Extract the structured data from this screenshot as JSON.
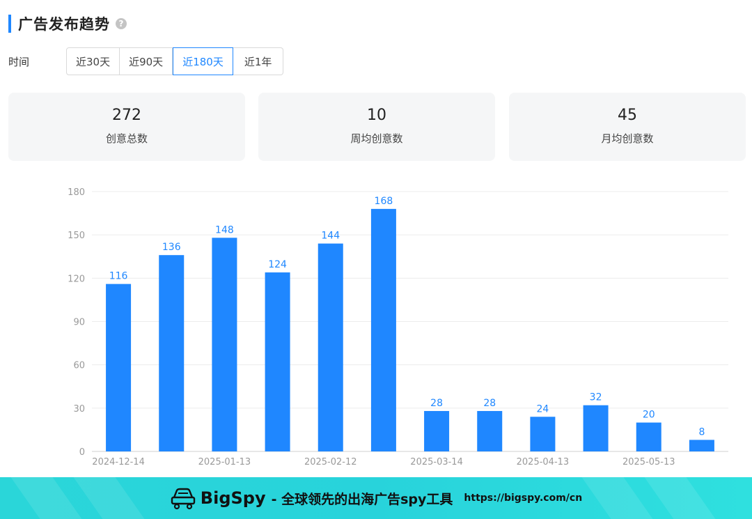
{
  "section": {
    "title": "广告发布趋势",
    "help_icon": "question-circle-icon"
  },
  "time_filter": {
    "label": "时间",
    "options": [
      "近30天",
      "近90天",
      "近180天",
      "近1年"
    ],
    "selected": "近180天"
  },
  "stats": [
    {
      "value": "272",
      "label": "创意总数"
    },
    {
      "value": "10",
      "label": "周均创意数"
    },
    {
      "value": "45",
      "label": "月均创意数"
    }
  ],
  "chart_data": {
    "type": "bar",
    "y_ticks": [
      0,
      30,
      60,
      90,
      120,
      150,
      180
    ],
    "ylim": [
      0,
      180
    ],
    "grid": true,
    "values": [
      116,
      136,
      148,
      124,
      144,
      168,
      28,
      28,
      24,
      32,
      20,
      8
    ],
    "x_tick_labels": [
      {
        "index": 0,
        "label": "2024-12-14"
      },
      {
        "index": 2,
        "label": "2025-01-13"
      },
      {
        "index": 4,
        "label": "2025-02-12"
      },
      {
        "index": 6,
        "label": "2025-03-14"
      },
      {
        "index": 8,
        "label": "2025-04-13"
      },
      {
        "index": 10,
        "label": "2025-05-13"
      }
    ],
    "bar_color": "#1f87ff",
    "label_color": "#1f87ff"
  },
  "footer": {
    "brand": "BigSpy",
    "slogan": "- 全球领先的出海广告spy工具",
    "url": "https://bigspy.com/cn",
    "logo_icon": "car-logo-icon"
  }
}
